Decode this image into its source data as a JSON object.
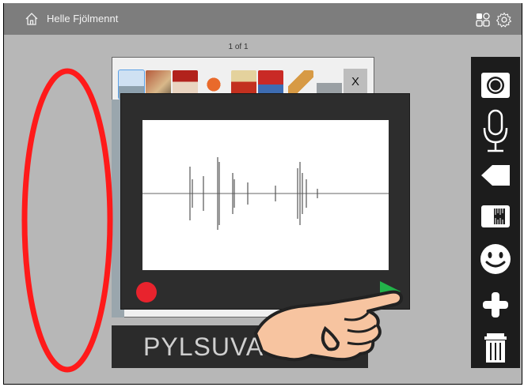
{
  "header": {
    "user_name": "Helle Fjölmennt",
    "home_icon": "home-icon",
    "apps_icon": "apps-icon",
    "settings_icon": "gear-icon"
  },
  "pager": {
    "label": "1 of 1"
  },
  "thumbnails": {
    "close_label": "X",
    "selected_index": 0
  },
  "audio": {
    "record_color": "#e8232d",
    "play_color": "#22b34a"
  },
  "card": {
    "label": "PYLSUVAGN"
  },
  "toolbar": {
    "items": [
      "camera-icon",
      "microphone-icon",
      "pencil-icon",
      "ruler-icon",
      "smiley-icon",
      "plus-icon",
      "trash-icon"
    ]
  },
  "annotation": {
    "oval_color": "#ff1a1a"
  }
}
